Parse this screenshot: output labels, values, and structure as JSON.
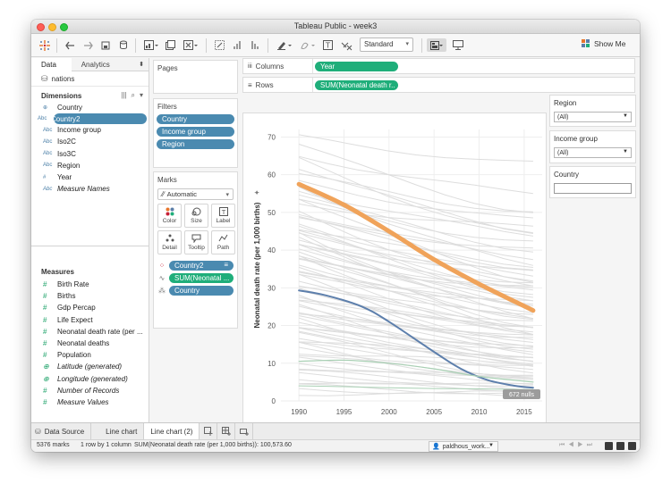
{
  "window": {
    "title": "Tableau Public - week3"
  },
  "toolbar": {
    "mark_size_value": "Standard",
    "show_me_label": "Show Me"
  },
  "data_pane": {
    "tab_data": "Data",
    "tab_analytics": "Analytics",
    "data_source": "nations",
    "dimensions_header": "Dimensions",
    "dimensions": [
      {
        "label": "Country",
        "icon": "globe-icon"
      },
      {
        "label": "Country2",
        "icon": "abc-icon"
      },
      {
        "label": "Income group",
        "icon": "abc-icon"
      },
      {
        "label": "Iso2C",
        "icon": "abc-icon"
      },
      {
        "label": "Iso3C",
        "icon": "abc-icon"
      },
      {
        "label": "Region",
        "icon": "abc-icon"
      },
      {
        "label": "Year",
        "icon": "hash-icon"
      },
      {
        "label": "Measure Names",
        "icon": "abc-icon"
      }
    ],
    "measures_header": "Measures",
    "measures": [
      {
        "label": "Birth Rate",
        "icon": "hash-icon"
      },
      {
        "label": "Births",
        "icon": "hash-icon"
      },
      {
        "label": "Gdp Percap",
        "icon": "hash-icon"
      },
      {
        "label": "Life Expect",
        "icon": "hash-icon"
      },
      {
        "label": "Neonatal death rate (per ...",
        "icon": "hash-icon"
      },
      {
        "label": "Neonatal deaths",
        "icon": "hash-icon"
      },
      {
        "label": "Population",
        "icon": "hash-icon"
      },
      {
        "label": "Latitude (generated)",
        "icon": "globe-icon"
      },
      {
        "label": "Longitude (generated)",
        "icon": "globe-icon"
      },
      {
        "label": "Number of Records",
        "icon": "hash-icon"
      },
      {
        "label": "Measure Values",
        "icon": "hash-icon"
      }
    ]
  },
  "cards": {
    "pages_title": "Pages",
    "filters_title": "Filters",
    "filters": [
      "Country",
      "Income group",
      "Region"
    ],
    "marks_title": "Marks",
    "mark_type": "Automatic",
    "mark_buttons": [
      "Color",
      "Size",
      "Label",
      "Detail",
      "Tooltip",
      "Path"
    ],
    "mark_fields": [
      "Country2",
      "SUM(Neonatal ...",
      "Country"
    ]
  },
  "shelves": {
    "columns_label": "Columns",
    "columns_pill": "Year",
    "rows_label": "Rows",
    "rows_pill": "SUM(Neonatal death r.."
  },
  "right_filters": {
    "region_title": "Region",
    "region_value": "(All)",
    "income_title": "Income group",
    "income_value": "(All)",
    "country_title": "Country"
  },
  "bottom": {
    "data_source_tab": "Data Source",
    "sheet_tabs": [
      "Line chart",
      "Line chart (2)"
    ]
  },
  "status": {
    "marks": "5376 marks",
    "grid": "1 row by 1 column",
    "sum": "SUM(Neonatal death rate (per 1,000 births)): 100,573.60",
    "user": "paldhous_work..."
  },
  "chart_data": {
    "type": "line",
    "ylabel": "Neonatal death rate (per 1,000 births)",
    "xlabel": "Year",
    "xlim": [
      1988,
      2017
    ],
    "ylim": [
      0,
      72
    ],
    "x_ticks": [
      1990,
      1995,
      2000,
      2005,
      2010,
      2015
    ],
    "y_ticks": [
      0,
      10,
      20,
      30,
      40,
      50,
      60,
      70
    ],
    "nulls_label": "672 nulls",
    "highlight_colors": [
      "#f0a35a",
      "#5d7fac",
      "#a9d0b4"
    ],
    "background_color": "#dddddd",
    "highlighted_series": [
      {
        "x": [
          1990,
          1995,
          2000,
          2005,
          2010,
          2016
        ],
        "y": [
          57.5,
          52,
          45,
          37.5,
          31,
          24
        ],
        "color": "#f0a35a",
        "width": 5
      },
      {
        "x": [
          1990,
          1993,
          1997,
          2000,
          2005,
          2008,
          2011,
          2014,
          2016
        ],
        "y": [
          29.3,
          28,
          25,
          21,
          13,
          8.5,
          5.5,
          4,
          3.5
        ],
        "color": "#5d7fac",
        "width": 2
      },
      {
        "x": [
          1990,
          1995,
          2000,
          2005,
          2010,
          2016
        ],
        "y": [
          10.5,
          10.8,
          10,
          8.5,
          6.5,
          5
        ],
        "color": "#a9d0b4",
        "width": 1.2
      },
      {
        "x": [
          1990,
          1995,
          2000,
          2005,
          2010,
          2016
        ],
        "y": [
          4,
          3.8,
          3.5,
          3.3,
          3.2,
          3
        ],
        "color": "#a9d0b4",
        "width": 1
      }
    ],
    "background_series_endpoints": [
      [
        70,
        63
      ],
      [
        65,
        55
      ],
      [
        62,
        45
      ],
      [
        60,
        50
      ],
      [
        58,
        48
      ],
      [
        56,
        44
      ],
      [
        55,
        40
      ],
      [
        53,
        42
      ],
      [
        52,
        46
      ],
      [
        50,
        38
      ],
      [
        49,
        35
      ],
      [
        48,
        40
      ],
      [
        47,
        33
      ],
      [
        46,
        36
      ],
      [
        45,
        30
      ],
      [
        44,
        34
      ],
      [
        43,
        32
      ],
      [
        42,
        28
      ],
      [
        41,
        31
      ],
      [
        40,
        29
      ],
      [
        39,
        27
      ],
      [
        38,
        26
      ],
      [
        37,
        30
      ],
      [
        36,
        25
      ],
      [
        35,
        24
      ],
      [
        34,
        23
      ],
      [
        33,
        26
      ],
      [
        32,
        22
      ],
      [
        31,
        20
      ],
      [
        30,
        21
      ],
      [
        29,
        19
      ],
      [
        28,
        18
      ],
      [
        27,
        20
      ],
      [
        26,
        17
      ],
      [
        25,
        16
      ],
      [
        24,
        15
      ],
      [
        23,
        17
      ],
      [
        22,
        14
      ],
      [
        21,
        13
      ],
      [
        20,
        12
      ],
      [
        19,
        14
      ],
      [
        18,
        11
      ],
      [
        17,
        10
      ],
      [
        16,
        12
      ],
      [
        15,
        9
      ],
      [
        14,
        8
      ],
      [
        13,
        10
      ],
      [
        12,
        7
      ],
      [
        11,
        6
      ],
      [
        10,
        6
      ],
      [
        9,
        5
      ],
      [
        8,
        4
      ],
      [
        7,
        4
      ],
      [
        6,
        3
      ],
      [
        5,
        3
      ],
      [
        4,
        2
      ],
      [
        3,
        2
      ],
      [
        2,
        1.5
      ],
      [
        30,
        14
      ],
      [
        25,
        10
      ],
      [
        22,
        9
      ],
      [
        20,
        8
      ],
      [
        18,
        6
      ],
      [
        15,
        5
      ],
      [
        45,
        22
      ],
      [
        40,
        20
      ],
      [
        35,
        18
      ],
      [
        50,
        30
      ],
      [
        42,
        25
      ],
      [
        38,
        22
      ],
      [
        33,
        15
      ],
      [
        28,
        12
      ],
      [
        24,
        11
      ],
      [
        68,
        50
      ],
      [
        64,
        44
      ],
      [
        57,
        36
      ],
      [
        54,
        32
      ],
      [
        46,
        28
      ],
      [
        43,
        24
      ],
      [
        39,
        18
      ]
    ]
  }
}
